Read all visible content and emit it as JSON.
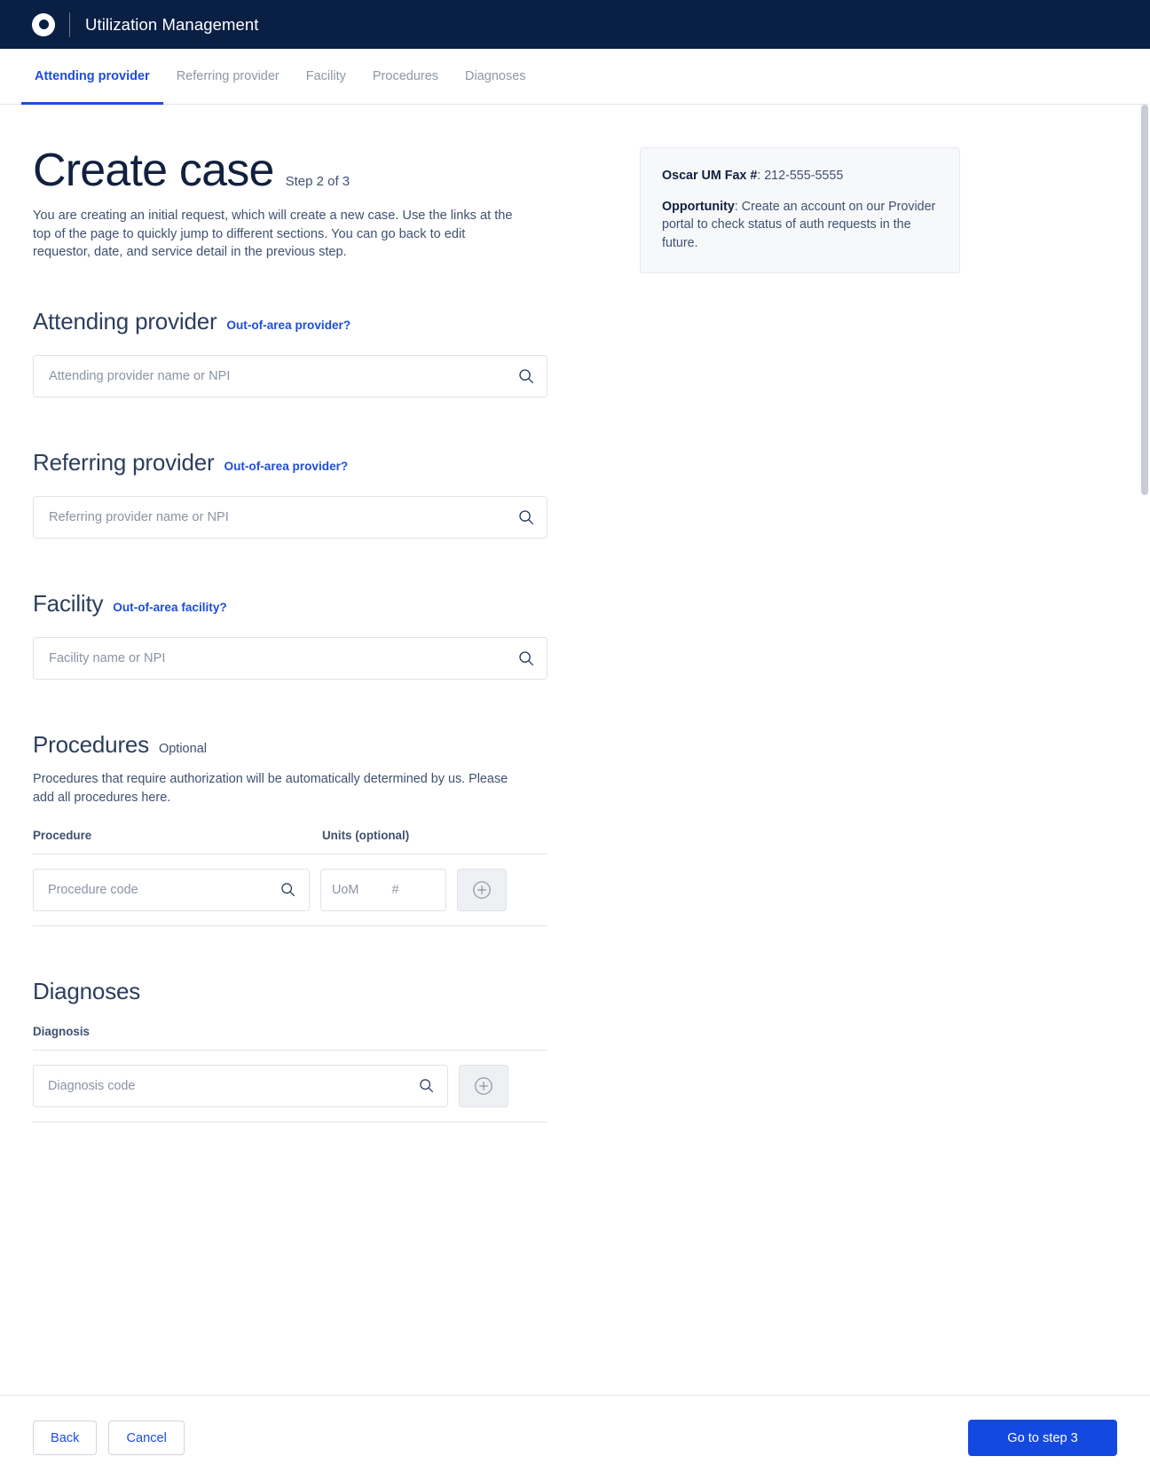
{
  "app": {
    "title": "Utilization Management",
    "logo_icon": "oscar-circle-logo"
  },
  "tabs": [
    {
      "label": "Attending provider",
      "active": true
    },
    {
      "label": "Referring provider",
      "active": false
    },
    {
      "label": "Facility",
      "active": false
    },
    {
      "label": "Procedures",
      "active": false
    },
    {
      "label": "Diagnoses",
      "active": false
    }
  ],
  "header": {
    "title": "Create case",
    "step": "Step 2 of 3",
    "intro": "You are creating an initial request, which will create a new case. Use the links at the top of the page to quickly jump to different sections. You can go back to edit requestor, date, and service detail in the previous step."
  },
  "info_card": {
    "fax_label": "Oscar UM Fax #",
    "fax_sep": ": ",
    "fax_value": "212-555-5555",
    "opportunity_label": "Opportunity",
    "opportunity_sep": ": ",
    "opportunity_value": "Create an account on our Provider portal to check status of auth requests in the future."
  },
  "attending_provider": {
    "title": "Attending provider",
    "link": "Out-of-area provider?",
    "placeholder": "Attending provider name or NPI",
    "value": ""
  },
  "referring_provider": {
    "title": "Referring provider",
    "link": "Out-of-area provider?",
    "placeholder": "Referring provider name or NPI",
    "value": ""
  },
  "facility": {
    "title": "Facility",
    "link": "Out-of-area facility?",
    "placeholder": "Facility name or NPI",
    "value": ""
  },
  "procedures": {
    "title": "Procedures",
    "optional_label": "Optional",
    "description": "Procedures that require authorization will be automatically determined by us. Please add all procedures here.",
    "columns": [
      "Procedure",
      "Units (optional)"
    ],
    "code_placeholder": "Procedure code",
    "uom_placeholder": "UoM",
    "qty_placeholder": "#",
    "code_value": "",
    "uom_value": "",
    "qty_value": "",
    "add_icon": "plus-circle-icon"
  },
  "diagnoses": {
    "title": "Diagnoses",
    "column": "Diagnosis",
    "code_placeholder": "Diagnosis code",
    "code_value": "",
    "add_icon": "plus-circle-icon"
  },
  "footer": {
    "back": "Back",
    "cancel": "Cancel",
    "next": "Go to step 3"
  },
  "colors": {
    "topbar": "#0a1f44",
    "accent": "#1d4ed8",
    "primary_button": "#1449e0",
    "text": "#3f5070",
    "heading": "#11203f",
    "border": "#dfe3e9",
    "card_bg": "#f7f8fa"
  }
}
